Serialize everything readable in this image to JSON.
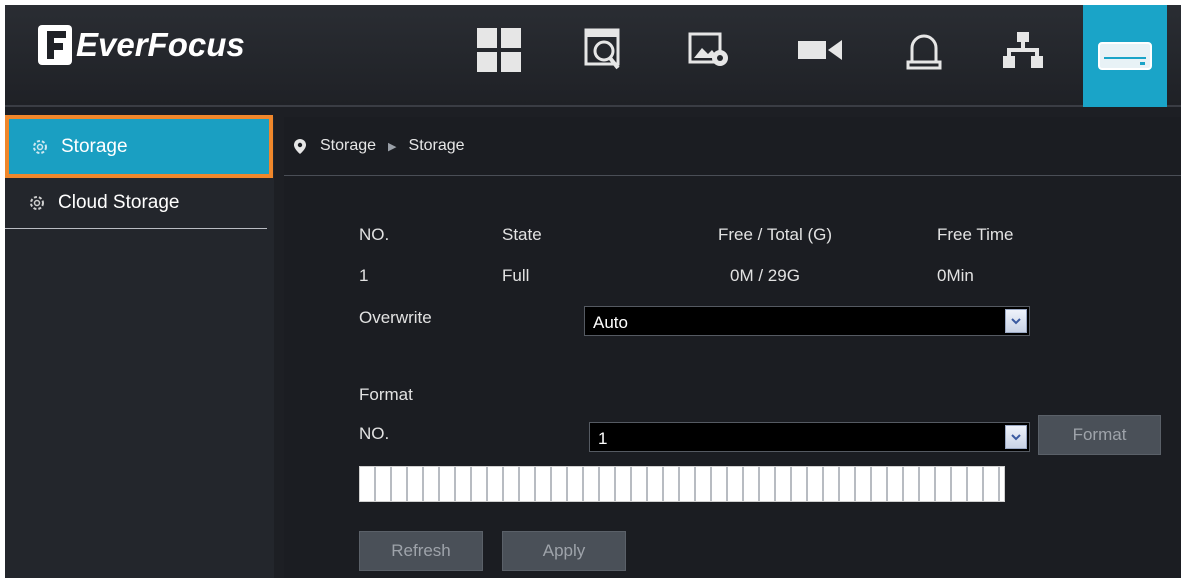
{
  "brand": {
    "name": "EverFocus"
  },
  "top_nav": [
    {
      "icon": "grid-layout-icon"
    },
    {
      "icon": "playback-search-icon"
    },
    {
      "icon": "image-settings-icon"
    },
    {
      "icon": "camera-icon"
    },
    {
      "icon": "alarm-icon"
    },
    {
      "icon": "network-icon"
    },
    {
      "icon": "hard-drive-icon",
      "active": true
    }
  ],
  "sidebar": {
    "items": [
      {
        "label": "Storage",
        "active": true
      },
      {
        "label": "Cloud Storage",
        "active": false
      }
    ]
  },
  "breadcrumb": [
    "Storage",
    "Storage"
  ],
  "disk_table": {
    "headers": [
      "NO.",
      "State",
      "Free / Total (G)",
      "Free Time"
    ],
    "rows": [
      [
        "1",
        "Full",
        "0M / 29G",
        "0Min"
      ]
    ]
  },
  "overwrite": {
    "label": "Overwrite",
    "value": "Auto"
  },
  "format": {
    "section_label": "Format",
    "no_label": "NO.",
    "no_value": "1",
    "button_label": "Format"
  },
  "buttons": {
    "refresh": "Refresh",
    "apply": "Apply"
  },
  "colors": {
    "accent": "#1aa4c8",
    "highlight": "#f0872b"
  }
}
